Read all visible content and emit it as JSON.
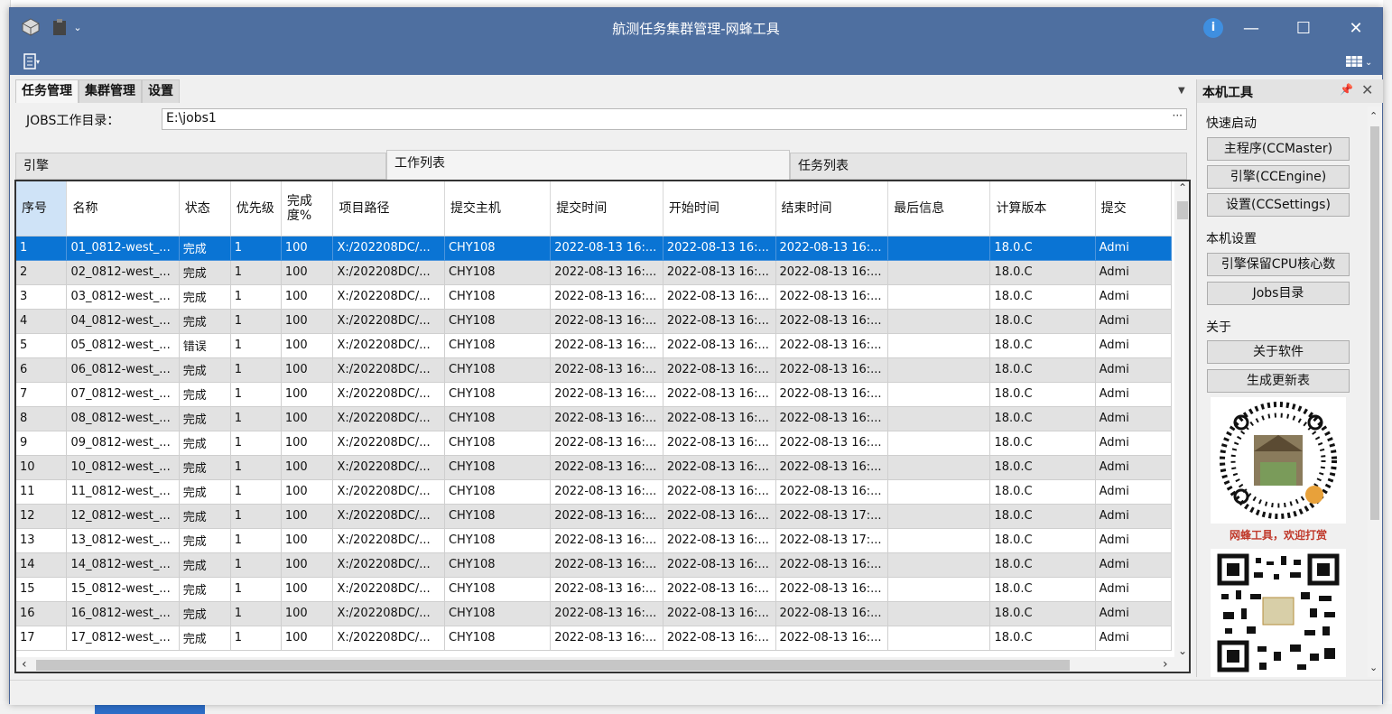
{
  "window": {
    "title": "航测任务集群管理-网蜂工具"
  },
  "tabs": [
    {
      "label": "任务管理",
      "active": true
    },
    {
      "label": "集群管理",
      "active": false
    },
    {
      "label": "设置",
      "active": false
    }
  ],
  "jobs_dir": {
    "label": "JOBS工作目录：",
    "value": "E:\\jobs1",
    "browse": "···"
  },
  "subtabs": [
    {
      "label": "引擎",
      "active": false
    },
    {
      "label": "工作列表",
      "active": true
    },
    {
      "label": "任务列表",
      "active": false
    }
  ],
  "table": {
    "columns": [
      "序号",
      "名称",
      "状态",
      "优先级",
      "完成度%",
      "项目路径",
      "提交主机",
      "提交时间",
      "开始时间",
      "结束时间",
      "最后信息",
      "计算版本",
      "提交"
    ],
    "rows": [
      [
        "1",
        "01_0812-west_...",
        "完成",
        "1",
        "100",
        "X:/202208DC/...",
        "CHY108",
        "2022-08-13 16:...",
        "2022-08-13 16:...",
        "2022-08-13 16:...",
        "",
        "18.0.C",
        "Admi"
      ],
      [
        "2",
        "02_0812-west_...",
        "完成",
        "1",
        "100",
        "X:/202208DC/...",
        "CHY108",
        "2022-08-13 16:...",
        "2022-08-13 16:...",
        "2022-08-13 16:...",
        "",
        "18.0.C",
        "Admi"
      ],
      [
        "3",
        "03_0812-west_...",
        "完成",
        "1",
        "100",
        "X:/202208DC/...",
        "CHY108",
        "2022-08-13 16:...",
        "2022-08-13 16:...",
        "2022-08-13 16:...",
        "",
        "18.0.C",
        "Admi"
      ],
      [
        "4",
        "04_0812-west_...",
        "完成",
        "1",
        "100",
        "X:/202208DC/...",
        "CHY108",
        "2022-08-13 16:...",
        "2022-08-13 16:...",
        "2022-08-13 16:...",
        "",
        "18.0.C",
        "Admi"
      ],
      [
        "5",
        "05_0812-west_...",
        "错误",
        "1",
        "100",
        "X:/202208DC/...",
        "CHY108",
        "2022-08-13 16:...",
        "2022-08-13 16:...",
        "2022-08-13 16:...",
        "",
        "18.0.C",
        "Admi"
      ],
      [
        "6",
        "06_0812-west_...",
        "完成",
        "1",
        "100",
        "X:/202208DC/...",
        "CHY108",
        "2022-08-13 16:...",
        "2022-08-13 16:...",
        "2022-08-13 16:...",
        "",
        "18.0.C",
        "Admi"
      ],
      [
        "7",
        "07_0812-west_...",
        "完成",
        "1",
        "100",
        "X:/202208DC/...",
        "CHY108",
        "2022-08-13 16:...",
        "2022-08-13 16:...",
        "2022-08-13 16:...",
        "",
        "18.0.C",
        "Admi"
      ],
      [
        "8",
        "08_0812-west_...",
        "完成",
        "1",
        "100",
        "X:/202208DC/...",
        "CHY108",
        "2022-08-13 16:...",
        "2022-08-13 16:...",
        "2022-08-13 16:...",
        "",
        "18.0.C",
        "Admi"
      ],
      [
        "9",
        "09_0812-west_...",
        "完成",
        "1",
        "100",
        "X:/202208DC/...",
        "CHY108",
        "2022-08-13 16:...",
        "2022-08-13 16:...",
        "2022-08-13 16:...",
        "",
        "18.0.C",
        "Admi"
      ],
      [
        "10",
        "10_0812-west_...",
        "完成",
        "1",
        "100",
        "X:/202208DC/...",
        "CHY108",
        "2022-08-13 16:...",
        "2022-08-13 16:...",
        "2022-08-13 16:...",
        "",
        "18.0.C",
        "Admi"
      ],
      [
        "11",
        "11_0812-west_...",
        "完成",
        "1",
        "100",
        "X:/202208DC/...",
        "CHY108",
        "2022-08-13 16:...",
        "2022-08-13 16:...",
        "2022-08-13 16:...",
        "",
        "18.0.C",
        "Admi"
      ],
      [
        "12",
        "12_0812-west_...",
        "完成",
        "1",
        "100",
        "X:/202208DC/...",
        "CHY108",
        "2022-08-13 16:...",
        "2022-08-13 16:...",
        "2022-08-13 17:...",
        "",
        "18.0.C",
        "Admi"
      ],
      [
        "13",
        "13_0812-west_...",
        "完成",
        "1",
        "100",
        "X:/202208DC/...",
        "CHY108",
        "2022-08-13 16:...",
        "2022-08-13 16:...",
        "2022-08-13 17:...",
        "",
        "18.0.C",
        "Admi"
      ],
      [
        "14",
        "14_0812-west_...",
        "完成",
        "1",
        "100",
        "X:/202208DC/...",
        "CHY108",
        "2022-08-13 16:...",
        "2022-08-13 16:...",
        "2022-08-13 16:...",
        "",
        "18.0.C",
        "Admi"
      ],
      [
        "15",
        "15_0812-west_...",
        "完成",
        "1",
        "100",
        "X:/202208DC/...",
        "CHY108",
        "2022-08-13 16:...",
        "2022-08-13 16:...",
        "2022-08-13 16:...",
        "",
        "18.0.C",
        "Admi"
      ],
      [
        "16",
        "16_0812-west_...",
        "完成",
        "1",
        "100",
        "X:/202208DC/...",
        "CHY108",
        "2022-08-13 16:...",
        "2022-08-13 16:...",
        "2022-08-13 16:...",
        "",
        "18.0.C",
        "Admi"
      ],
      [
        "17",
        "17_0812-west_...",
        "完成",
        "1",
        "100",
        "X:/202208DC/...",
        "CHY108",
        "2022-08-13 16:...",
        "2022-08-13 16:...",
        "2022-08-13 16:...",
        "",
        "18.0.C",
        "Admi"
      ]
    ]
  },
  "side_panel": {
    "title": "本机工具",
    "groups": [
      {
        "label": "快速启动",
        "buttons": [
          "主程序(CCMaster)",
          "引擎(CCEngine)",
          "设置(CCSettings)"
        ]
      },
      {
        "label": "本机设置",
        "buttons": [
          "引擎保留CPU核心数",
          "Jobs目录"
        ]
      },
      {
        "label": "关于",
        "buttons": [
          "关于软件",
          "生成更新表"
        ]
      }
    ],
    "qr_caption": "网蜂工具，欢迎打赏"
  },
  "colors": {
    "titlebar": "#4e6fa0",
    "selection": "#0a74d4",
    "alt_row": "#e2e2e2"
  }
}
